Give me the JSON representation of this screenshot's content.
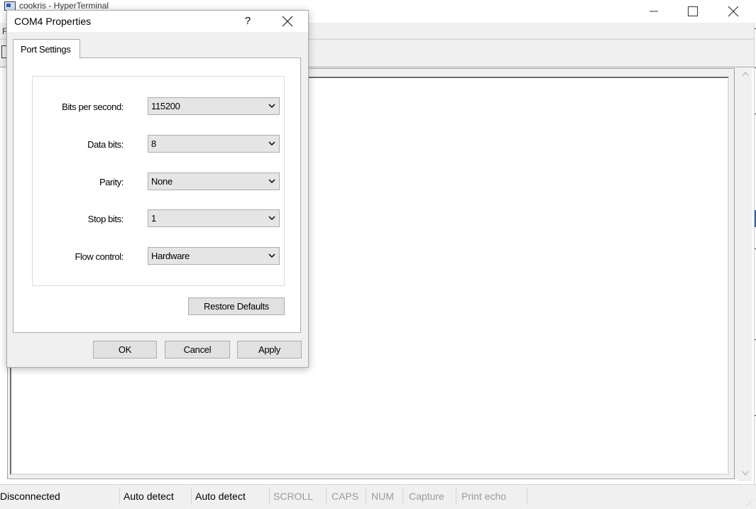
{
  "main_window": {
    "title": "cookris - HyperTerminal",
    "menu_first_letter": "F"
  },
  "dialog": {
    "title": "COM4 Properties",
    "help_glyph": "?",
    "tab_label": "Port Settings",
    "fields": [
      {
        "label": "Bits per second:",
        "value": "115200"
      },
      {
        "label": "Data bits:",
        "value": "8"
      },
      {
        "label": "Parity:",
        "value": "None"
      },
      {
        "label": "Stop bits:",
        "value": "1"
      },
      {
        "label": "Flow control:",
        "value": "Hardware"
      }
    ],
    "restore_defaults_label": "Restore Defaults",
    "ok_label": "OK",
    "cancel_label": "Cancel",
    "apply_label": "Apply"
  },
  "statusbar": {
    "connection": "Disconnected",
    "detect1": "Auto detect",
    "detect2": "Auto detect",
    "scroll": "SCROLL",
    "caps": "CAPS",
    "num": "NUM",
    "capture": "Capture",
    "print_echo": "Print echo"
  },
  "icons": {
    "minimize": "minimize-icon",
    "maximize": "maximize-icon",
    "close": "close-icon",
    "dropdown": "chevron-down-icon",
    "scroll_up": "scroll-up-arrow",
    "scroll_down": "scroll-down-arrow"
  }
}
